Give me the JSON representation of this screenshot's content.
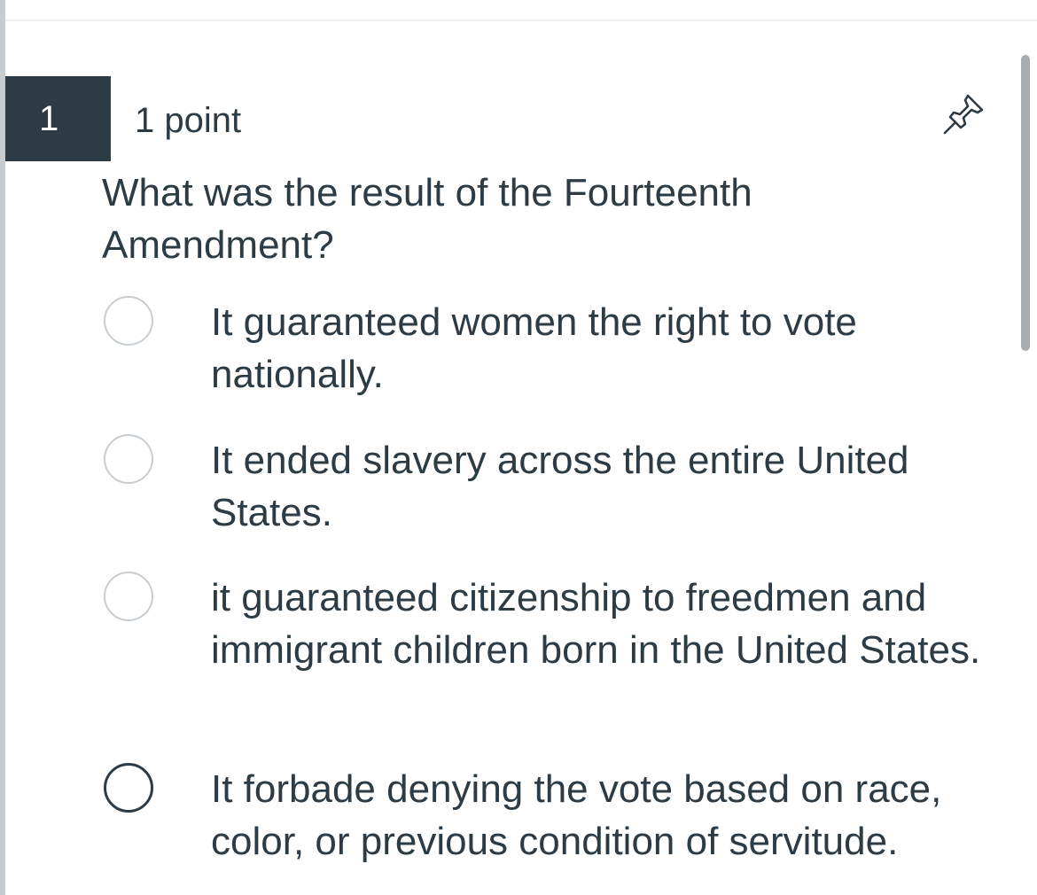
{
  "question": {
    "number": "1",
    "points": "1 point",
    "text": "What was the result of the Fourteenth Amendment?"
  },
  "answers": [
    {
      "text": "It guaranteed women the right to vote nationally."
    },
    {
      "text": "It ended slavery across the entire United States."
    },
    {
      "text": "it guaranteed citizenship to freedmen and immigrant children born in the United States."
    },
    {
      "text": "It forbade denying the vote based on race, color, or previous condition of servitude."
    }
  ],
  "icons": {
    "pin": "pushpin-icon",
    "radio": "radio-button"
  },
  "colors": {
    "text": "#2d3b45",
    "number_badge": "#2d3b45",
    "radio_border": "#c7cdd1",
    "scrollbar": "#a7adb1"
  }
}
